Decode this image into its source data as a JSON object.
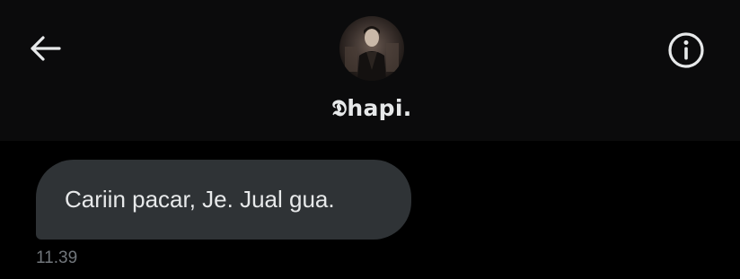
{
  "header": {
    "back_icon": "arrow-left-icon",
    "info_icon": "info-circle-icon",
    "contact_name": "𝕯hapi.",
    "avatar": "profile-photo"
  },
  "messages": [
    {
      "direction": "incoming",
      "text": "Cariin pacar, Je. Jual gua.",
      "time": "11.39"
    }
  ],
  "colors": {
    "background": "#000000",
    "header_background": "#0b0b0c",
    "bubble_incoming": "#2f3336",
    "text_primary": "#e7e9ea",
    "text_secondary": "#71767b"
  }
}
